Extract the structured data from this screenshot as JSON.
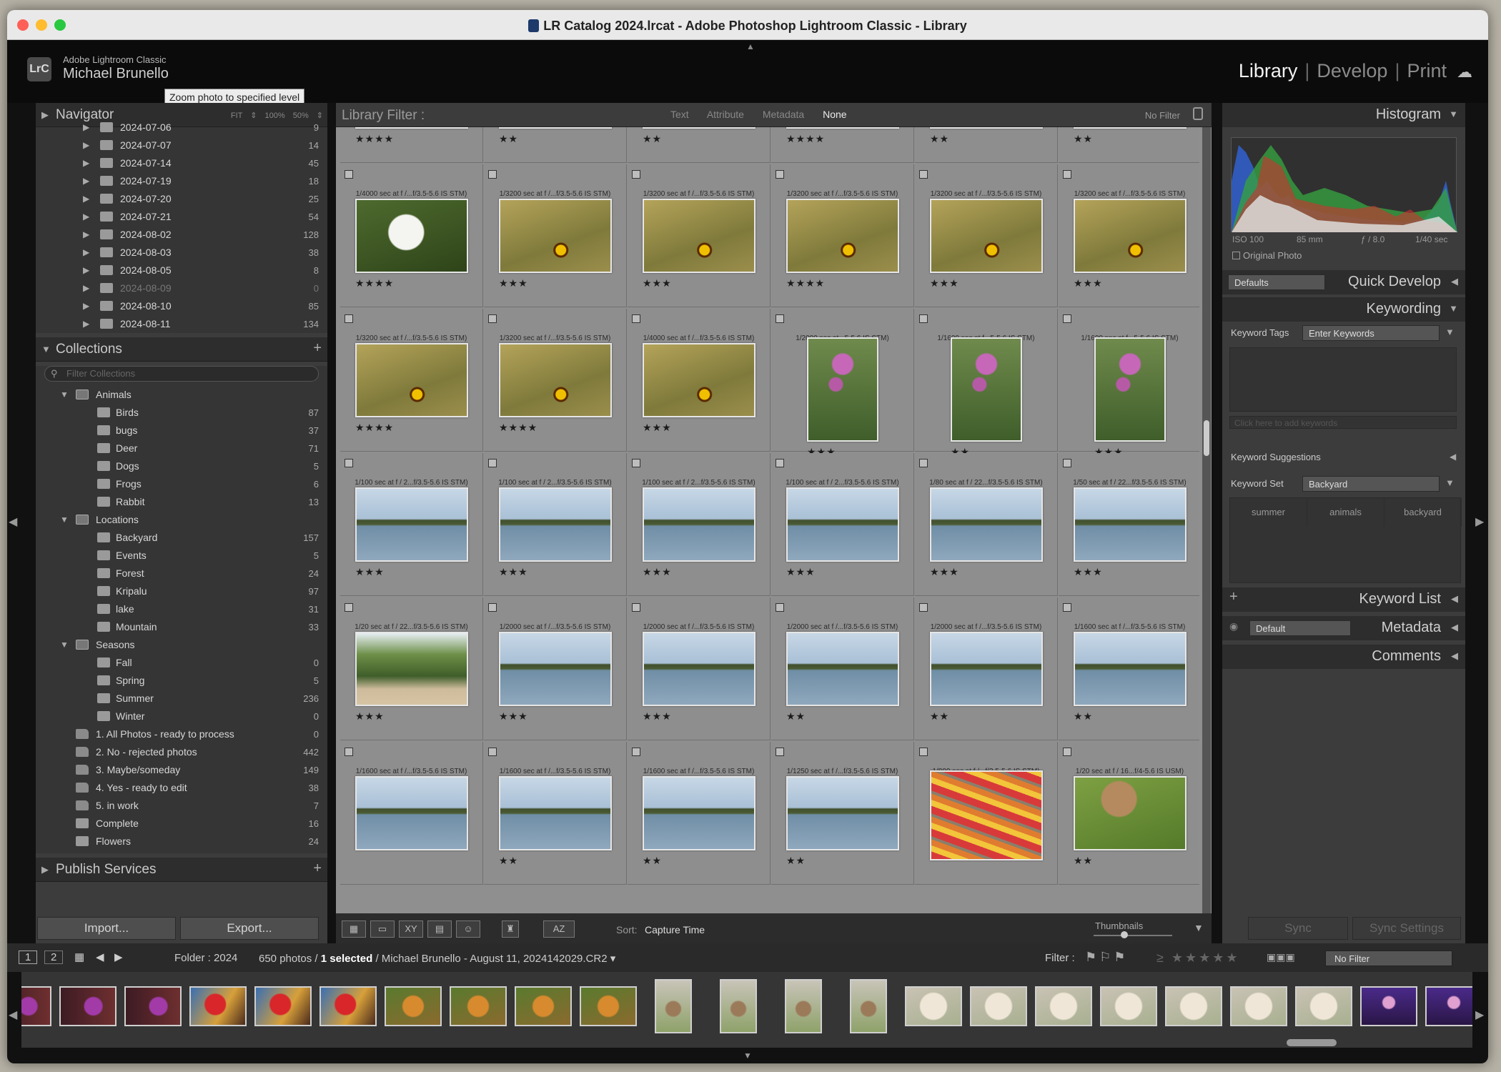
{
  "window": {
    "title": "LR Catalog 2024.lrcat - Adobe Photoshop Lightroom Classic - Library"
  },
  "identity": {
    "app": "Adobe Lightroom Classic",
    "user": "Michael Brunello",
    "badge": "LrC",
    "tooltip": "Zoom photo to specified level"
  },
  "modules": {
    "library": "Library",
    "develop": "Develop",
    "print": "Print"
  },
  "navigator": {
    "title": "Navigator",
    "zoom": "FIT ⇕   100%   50% ⇕"
  },
  "folders": [
    {
      "name": "2024-07-06",
      "count": "9"
    },
    {
      "name": "2024-07-07",
      "count": "14"
    },
    {
      "name": "2024-07-14",
      "count": "45"
    },
    {
      "name": "2024-07-19",
      "count": "18"
    },
    {
      "name": "2024-07-20",
      "count": "25"
    },
    {
      "name": "2024-07-21",
      "count": "54"
    },
    {
      "name": "2024-08-02",
      "count": "128"
    },
    {
      "name": "2024-08-03",
      "count": "38"
    },
    {
      "name": "2024-08-05",
      "count": "8"
    },
    {
      "name": "2024-08-09",
      "count": "0"
    },
    {
      "name": "2024-08-10",
      "count": "85"
    },
    {
      "name": "2024-08-11",
      "count": "134"
    }
  ],
  "collections": {
    "title": "Collections",
    "filter_placeholder": "Filter Collections",
    "items": [
      {
        "name": "Animals",
        "count": "",
        "type": "set"
      },
      {
        "name": "Birds",
        "count": "87",
        "type": "child"
      },
      {
        "name": "bugs",
        "count": "37",
        "type": "child"
      },
      {
        "name": "Deer",
        "count": "71",
        "type": "child"
      },
      {
        "name": "Dogs",
        "count": "5",
        "type": "child"
      },
      {
        "name": "Frogs",
        "count": "6",
        "type": "child"
      },
      {
        "name": "Rabbit",
        "count": "13",
        "type": "child"
      },
      {
        "name": "Locations",
        "count": "",
        "type": "set"
      },
      {
        "name": "Backyard",
        "count": "157",
        "type": "child"
      },
      {
        "name": "Events",
        "count": "5",
        "type": "child"
      },
      {
        "name": "Forest",
        "count": "24",
        "type": "child"
      },
      {
        "name": "Kripalu",
        "count": "97",
        "type": "child"
      },
      {
        "name": "lake",
        "count": "31",
        "type": "child"
      },
      {
        "name": "Mountain",
        "count": "33",
        "type": "child"
      },
      {
        "name": "Seasons",
        "count": "",
        "type": "set"
      },
      {
        "name": "Fall",
        "count": "0",
        "type": "child"
      },
      {
        "name": "Spring",
        "count": "5",
        "type": "child"
      },
      {
        "name": "Summer",
        "count": "236",
        "type": "child"
      },
      {
        "name": "Winter",
        "count": "0",
        "type": "child"
      },
      {
        "name": "1. All Photos - ready to process",
        "count": "0",
        "type": "smart"
      },
      {
        "name": "2. No - rejected photos",
        "count": "442",
        "type": "smart"
      },
      {
        "name": "3. Maybe/someday",
        "count": "149",
        "type": "smart"
      },
      {
        "name": "4. Yes - ready to edit",
        "count": "38",
        "type": "smart"
      },
      {
        "name": "5. in work",
        "count": "7",
        "type": "smart"
      },
      {
        "name": "Complete",
        "count": "16",
        "type": "top"
      },
      {
        "name": "Flowers",
        "count": "24",
        "type": "top"
      }
    ]
  },
  "publish": {
    "title": "Publish Services"
  },
  "left_buttons": {
    "import": "Import...",
    "export": "Export..."
  },
  "library_filter": {
    "label": "Library Filter :",
    "tabs": [
      "Text",
      "Attribute",
      "Metadata",
      "None"
    ],
    "preset": "No Filter"
  },
  "grid": {
    "rows": [
      {
        "cells": [
          {
            "info": "",
            "stars": "★★★★",
            "kind": "flower"
          },
          {
            "info": "",
            "stars": "★★",
            "kind": "flower"
          },
          {
            "info": "",
            "stars": "★★",
            "kind": "flower"
          },
          {
            "info": "",
            "stars": "★★★★",
            "kind": "flower"
          },
          {
            "info": "",
            "stars": "★★",
            "kind": "flower"
          },
          {
            "info": "",
            "stars": "★★",
            "kind": "flower"
          }
        ]
      },
      {
        "cells": [
          {
            "info": "1/4000 sec at f /...f/3.5-5.6 IS STM)",
            "stars": "★★★★",
            "kind": "white"
          },
          {
            "info": "1/3200 sec at f /...f/3.5-5.6 IS STM)",
            "stars": "★★★",
            "kind": "flower"
          },
          {
            "info": "1/3200 sec at f /...f/3.5-5.6 IS STM)",
            "stars": "★★★",
            "kind": "flower"
          },
          {
            "info": "1/3200 sec at f /...f/3.5-5.6 IS STM)",
            "stars": "★★★★",
            "kind": "flower"
          },
          {
            "info": "1/3200 sec at f /...f/3.5-5.6 IS STM)",
            "stars": "★★★",
            "kind": "flower"
          },
          {
            "info": "1/3200 sec at f /...f/3.5-5.6 IS STM)",
            "stars": "★★★",
            "kind": "flower"
          }
        ]
      },
      {
        "cells": [
          {
            "info": "1/3200 sec at f /...f/3.5-5.6 IS STM)",
            "stars": "★★★★",
            "kind": "flower"
          },
          {
            "info": "1/3200 sec at f /...f/3.5-5.6 IS STM)",
            "stars": "★★★★",
            "kind": "flower"
          },
          {
            "info": "1/4000 sec at f /...f/3.5-5.6 IS STM)",
            "stars": "★★★",
            "kind": "flower"
          },
          {
            "info": "1/2000 sec at...5-5.6 IS STM)",
            "stars": "★★★",
            "kind": "pink"
          },
          {
            "info": "1/1600 sec at f...5-5.6 IS STM)",
            "stars": "★★",
            "kind": "pink"
          },
          {
            "info": "1/1600 sec at f...5-5.6 IS STM)",
            "stars": "★★★",
            "kind": "pink"
          }
        ]
      },
      {
        "cells": [
          {
            "info": "1/100 sec at f / 2...f/3.5-5.6 IS STM)",
            "stars": "★★★",
            "kind": "lake"
          },
          {
            "info": "1/100 sec at f / 2...f/3.5-5.6 IS STM)",
            "stars": "★★★",
            "kind": "lake"
          },
          {
            "info": "1/100 sec at f / 2...f/3.5-5.6 IS STM)",
            "stars": "★★★",
            "kind": "lake"
          },
          {
            "info": "1/100 sec at f / 2...f/3.5-5.6 IS STM)",
            "stars": "★★★",
            "kind": "lake"
          },
          {
            "info": "1/80 sec at f / 22...f/3.5-5.6 IS STM)",
            "stars": "★★★",
            "kind": "lake"
          },
          {
            "info": "1/50 sec at f / 22...f/3.5-5.6 IS STM)",
            "stars": "★★★",
            "kind": "lake"
          }
        ]
      },
      {
        "cells": [
          {
            "info": "1/20 sec at f / 22...f/3.5-5.6 IS STM)",
            "stars": "★★★",
            "kind": "beach"
          },
          {
            "info": "1/2000 sec at f /...f/3.5-5.6 IS STM)",
            "stars": "★★★",
            "kind": "lake"
          },
          {
            "info": "1/2000 sec at f /...f/3.5-5.6 IS STM)",
            "stars": "★★★",
            "kind": "lake"
          },
          {
            "info": "1/2000 sec at f /...f/3.5-5.6 IS STM)",
            "stars": "★★",
            "kind": "lake"
          },
          {
            "info": "1/2000 sec at f /...f/3.5-5.6 IS STM)",
            "stars": "★★",
            "kind": "lake"
          },
          {
            "info": "1/1600 sec at f /...f/3.5-5.6 IS STM)",
            "stars": "★★",
            "kind": "lake"
          }
        ]
      },
      {
        "cells": [
          {
            "info": "1/1600 sec at f /...f/3.5-5.6 IS STM)",
            "stars": "",
            "kind": "lake"
          },
          {
            "info": "1/1600 sec at f /...f/3.5-5.6 IS STM)",
            "stars": "★★",
            "kind": "lake"
          },
          {
            "info": "1/1600 sec at f /...f/3.5-5.6 IS STM)",
            "stars": "★★",
            "kind": "lake"
          },
          {
            "info": "1/1250 sec at f /...f/3.5-5.6 IS STM)",
            "stars": "★★",
            "kind": "lake"
          },
          {
            "info": "1/800 sec at f /...f/3.5-5.6 IS STM)",
            "stars": "",
            "kind": "kayak"
          },
          {
            "info": "1/20 sec at f / 16...f/4-5.6 IS USM)",
            "stars": "★★",
            "kind": "deer"
          }
        ]
      }
    ]
  },
  "toolbar": {
    "sort_label": "Sort:",
    "sort_value": "Capture Time",
    "thumbnails": "Thumbnails"
  },
  "histogram": {
    "title": "Histogram",
    "iso": "ISO 100",
    "focal": "85 mm",
    "aperture": "ƒ / 8.0",
    "shutter": "1/40 sec",
    "original_photo": "Original Photo"
  },
  "quick_develop": {
    "title": "Quick Develop",
    "preset": "Defaults"
  },
  "keywording": {
    "title": "Keywording",
    "tags_label": "Keyword Tags",
    "tags_mode": "Enter Keywords",
    "add_placeholder": "Click here to add keywords",
    "suggestions": "Keyword Suggestions",
    "set_label": "Keyword Set",
    "set_value": "Backyard",
    "set_keywords": [
      "summer",
      "animals",
      "backyard"
    ]
  },
  "keyword_list": {
    "title": "Keyword List"
  },
  "metadata": {
    "title": "Metadata",
    "preset": "Default"
  },
  "comments": {
    "title": "Comments"
  },
  "right_buttons": {
    "sync": "Sync",
    "sync_settings": "Sync Settings"
  },
  "filmstrip": {
    "page1": "1",
    "page2": "2",
    "folder": "Folder : 2024",
    "count_prefix": "650 photos /",
    "selected": "1 selected",
    "path": "/ Michael Brunello - August 11, 2024142029.CR2",
    "filter_label": "Filter :",
    "filter_value": "No Filter",
    "thumbs": [
      "purple",
      "purple",
      "purple",
      "parrot",
      "parrot",
      "parrot",
      "tiger",
      "tiger",
      "tiger",
      "tiger",
      "deer-v",
      "deer-v",
      "deer-v",
      "deer-v",
      "goat",
      "goat",
      "goat",
      "goat",
      "goat",
      "goat",
      "goat",
      "concert",
      "concert"
    ]
  }
}
